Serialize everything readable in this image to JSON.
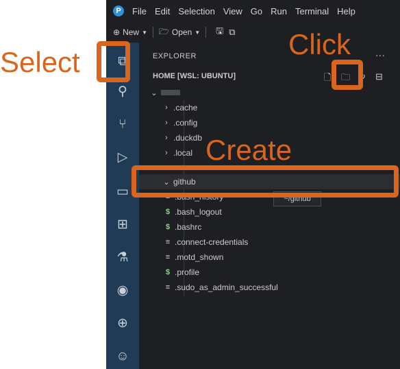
{
  "menubar": {
    "items": [
      "File",
      "Edit",
      "Selection",
      "View",
      "Go",
      "Run",
      "Terminal",
      "Help"
    ]
  },
  "toolbar": {
    "new_label": "New",
    "open_label": "Open"
  },
  "activity_bar": {
    "icons": [
      "explorer-icon",
      "search-icon",
      "source-control-icon",
      "run-debug-icon",
      "remote-explorer-icon",
      "extensions-icon",
      "testing-icon",
      "github-icon",
      "publish-icon",
      "accounts-icon"
    ]
  },
  "explorer": {
    "title": "EXPLORER",
    "section_title": "HOME [WSL: UBUNTU]",
    "root_label": "",
    "items": [
      {
        "label": ".cache",
        "kind": "folder"
      },
      {
        "label": ".config",
        "kind": "folder"
      },
      {
        "label": ".duckdb",
        "kind": "folder"
      },
      {
        "label": ".local",
        "kind": "folder"
      },
      {
        "label": "",
        "kind": "folder"
      },
      {
        "label": "github",
        "kind": "folder-open"
      },
      {
        "label": ".bash_history",
        "kind": "file"
      },
      {
        "label": ".bash_logout",
        "kind": "shell"
      },
      {
        "label": ".bashrc",
        "kind": "shell"
      },
      {
        "label": ".connect-credentials",
        "kind": "file"
      },
      {
        "label": ".motd_shown",
        "kind": "file"
      },
      {
        "label": ".profile",
        "kind": "shell"
      },
      {
        "label": ".sudo_as_admin_successful",
        "kind": "file"
      }
    ],
    "tooltip": "~/github"
  },
  "annotations": {
    "select": "Select",
    "click": "Click",
    "create": "Create",
    "color": "#d9661f"
  }
}
